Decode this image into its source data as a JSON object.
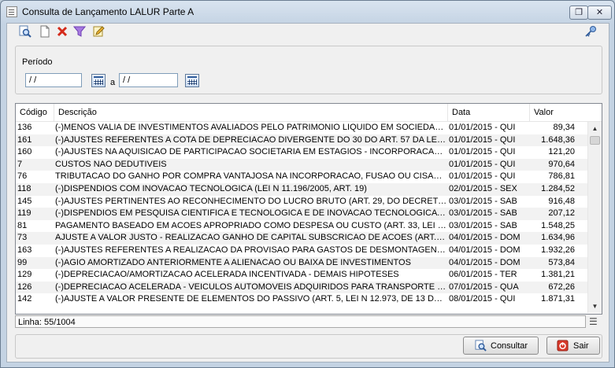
{
  "window": {
    "title": "Consulta de Lançamento LALUR Parte A",
    "restore_glyph": "❐",
    "close_glyph": "✕"
  },
  "toolbar": {
    "icons": [
      "search-icon",
      "new-document-icon",
      "delete-icon",
      "filter-icon",
      "edit-icon",
      "key-icon"
    ]
  },
  "filter": {
    "periodo_label": "Período",
    "date_start": "/ /",
    "date_end": "/ /",
    "separator": "a"
  },
  "table": {
    "columns": [
      "Código",
      "Descrição",
      "Data",
      "Valor"
    ],
    "rows": [
      {
        "codigo": "136",
        "descricao": "(-)MENOS VALIA DE INVESTIMENTOS AVALIADOS PELO PATRIMONIO LIQUIDO EM SOCIEDADES EST...",
        "data": "01/01/2015 - QUI",
        "valor": "89,34"
      },
      {
        "codigo": "161",
        "descricao": "(-)AJUSTES REFERENTES A COTA DE DEPRECIACAO DIVERGENTE DO  30 DO ART. 57 DA LEI NO 4....",
        "data": "01/01/2015 - QUI",
        "valor": "1.648,36"
      },
      {
        "codigo": "160",
        "descricao": "(-)AJUSTES NA AQUISICAO DE PARTICIPACAO SOCIETARIA EM ESTAGIOS - INCORPORACAO, FUS...",
        "data": "01/01/2015 - QUI",
        "valor": "121,20"
      },
      {
        "codigo": "7",
        "descricao": "CUSTOS NAO DEDUTIVEIS",
        "data": "01/01/2015 - QUI",
        "valor": "970,64"
      },
      {
        "codigo": "76",
        "descricao": "TRIBUTACAO DO GANHO POR COMPRA VANTAJOSA NA INCORPORACAO, FUSAO OU CISAO (ART. ...",
        "data": "01/01/2015 - QUI",
        "valor": "786,81"
      },
      {
        "codigo": "118",
        "descricao": "(-)DISPENDIOS COM INOVACAO TECNOLOGICA (LEI N 11.196/2005, ART. 19)",
        "data": "02/01/2015 - SEX",
        "valor": "1.284,52"
      },
      {
        "codigo": "145",
        "descricao": "(-)AJUSTES PERTINENTES AO RECONHECIMENTO DO LUCRO BRUTO (ART. 29, DO DECRETO-LEI N...",
        "data": "03/01/2015 - SAB",
        "valor": "916,48"
      },
      {
        "codigo": "119",
        "descricao": "(-)DISPENDIOS EM PESQUISA CIENTIFICA E TECNOLOGICA E DE INOVACAO TECNOLOGICA POR IC...",
        "data": "03/01/2015 - SAB",
        "valor": "207,12"
      },
      {
        "codigo": "81",
        "descricao": "PAGAMENTO BASEADO EM ACOES APROPRIADO COMO DESPESA OU CUSTO (ART. 33, LEI N 12.97...",
        "data": "03/01/2015 - SAB",
        "valor": "1.548,25"
      },
      {
        "codigo": "73",
        "descricao": "AJUSTE A VALOR JUSTO - REALIZACAO GANHO DE CAPITAL SUBSCRICAO DE ACOES (ART. 17, LEI ...",
        "data": "04/01/2015 - DOM",
        "valor": "1.634,96"
      },
      {
        "codigo": "163",
        "descricao": "(-)AJUSTES REFERENTES A REALIZACAO DA PROVISAO PARA GASTOS DE DESMONTAGENS (ART. 4...",
        "data": "04/01/2015 - DOM",
        "valor": "1.932,26"
      },
      {
        "codigo": "99",
        "descricao": "(-)AGIO AMORTIZADO ANTERIORMENTE A ALIENACAO OU BAIXA DE INVESTIMENTOS",
        "data": "04/01/2015 - DOM",
        "valor": "573,84"
      },
      {
        "codigo": "129",
        "descricao": "(-)DEPRECIACAO/AMORTIZACAO ACELERADA INCENTIVADA - DEMAIS HIPOTESES",
        "data": "06/01/2015 - TER",
        "valor": "1.381,21"
      },
      {
        "codigo": "126",
        "descricao": "(-)DEPRECIACAO ACELERADA - VEICULOS AUTOMOVEIS ADQUIRIDOS PARA TRANSPORTE DE MER...",
        "data": "07/01/2015 - QUA",
        "valor": "672,26"
      },
      {
        "codigo": "142",
        "descricao": "(-)AJUSTE A VALOR PRESENTE DE ELEMENTOS DO PASSIVO (ART. 5, LEI N 12.973, DE 13 DE MAIO ...",
        "data": "08/01/2015 - QUI",
        "valor": "1.871,31"
      }
    ]
  },
  "status": {
    "linha": "Linha: 55/1004"
  },
  "buttons": {
    "consultar": "Consultar",
    "sair": "Sair"
  },
  "colors": {
    "accent": "#2f5b9a",
    "delete": "#d42a1a",
    "filter": "#8a4fc7",
    "sair": "#c0392b"
  }
}
